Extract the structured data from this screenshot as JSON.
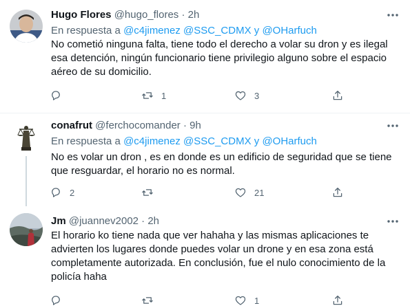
{
  "tweets": [
    {
      "name": "Hugo Flores",
      "handle": "@hugo_flores",
      "dot": "·",
      "time": "2h",
      "reply_prefix": "En respuesta a",
      "mentions": [
        "@c4jimenez",
        "@SSC_CDMX"
      ],
      "reply_and": "y",
      "last_mention": "@OHarfuch",
      "text": "No cometió ninguna falta, tiene todo el derecho a volar su dron y es ilegal esa detención, ningún funcionario tiene privilegio alguno sobre el espacio aéreo de su domicilio.",
      "reply_count": "",
      "retweet_count": "1",
      "like_count": "3",
      "icons": {
        "reply": "reply-icon",
        "retweet": "retweet-icon",
        "like": "heart-icon",
        "share": "share-icon",
        "more": "more-icon"
      }
    },
    {
      "name": "conafrut",
      "handle": "@ferchocomander",
      "dot": "·",
      "time": "9h",
      "reply_prefix": "En respuesta a",
      "mentions": [
        "@c4jimenez",
        "@SSC_CDMX"
      ],
      "reply_and": "y",
      "last_mention": "@OHarfuch",
      "text": "No es volar un dron , es en donde es un edificio de seguridad que se tiene que resguardar, el horario no es normal.",
      "reply_count": "2",
      "retweet_count": "",
      "like_count": "21"
    },
    {
      "name": "Jm",
      "handle": "@juannev2002",
      "dot": "·",
      "time": "2h",
      "text": "El horario ko tiene nada que ver hahaha y las mismas aplicaciones te advierten los lugares donde puedes volar un drone y en esa zona está completamente autorizada. En conclusión, fue el nulo conocimiento de la policía haha",
      "reply_count": "",
      "retweet_count": "",
      "like_count": "1"
    }
  ],
  "colors": {
    "accent": "#1d9bf0",
    "text": "#0f1419",
    "secondary": "#536471",
    "divider": "#eff3f4",
    "thread_line": "#cfd9de"
  }
}
